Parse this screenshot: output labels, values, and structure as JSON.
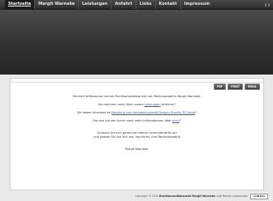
{
  "nav": {
    "items": [
      {
        "label": "Startseite",
        "active": true
      },
      {
        "label": "Margit Warneke",
        "active": false
      },
      {
        "label": "Leistungen",
        "active": false
      },
      {
        "label": "Anfahrt",
        "active": false
      },
      {
        "label": "Links",
        "active": false
      },
      {
        "label": "Kontakt",
        "active": false
      },
      {
        "label": "Impressum",
        "active": false
      }
    ]
  },
  "toolbar": {
    "pdf": "PDF",
    "print": "PRINT",
    "email": "EMAIL"
  },
  "content": {
    "welcome": "Herzlich Willkommen bei der Rechtsanwaltskanzlei von Rechtsanwältin Margit Warneke.",
    "q1_pre": "Sie möchten mehr über unsere ",
    "q1_link": "Leistungen",
    "q1_post": " erfahren?",
    "q2_pre": "Sie haben Interesse an ",
    "q2_link": "Beratung zum Immobilienkredit Morgan Stanley P2 Value",
    "q2_post": "?",
    "q3_pre": "Sie sind auf der Suche nach mehr Informationen über ",
    "q3_link": "mich",
    "q3_post": "?",
    "closing1": "Schauen Sie sich gerne auf meinen Internetauftritt um",
    "closing2": "und passen Sie auf sich auf, herzlichst, Ihre Rechtsanwältin",
    "signature": "Margit Warneke."
  },
  "footer": {
    "copyright": "Copyright © 2010 ",
    "firm": "Rechtsanwaltskanzlei Margit Warneke",
    "rights": ". Alle Rechte vorbehalten.",
    "badge": "CONTAO"
  }
}
